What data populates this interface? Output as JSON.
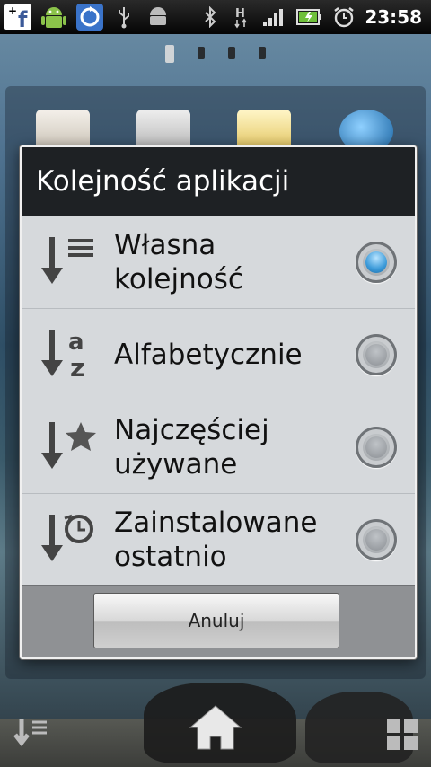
{
  "status_bar": {
    "time": "23:58",
    "icons": [
      "facebook-icon",
      "android-icon",
      "sync-icon",
      "usb-icon",
      "android-debug-icon",
      "bluetooth-icon",
      "hspa-data-icon",
      "signal-icon",
      "battery-charging-icon",
      "alarm-clock-icon"
    ]
  },
  "dialog": {
    "title": "Kolejność aplikacji",
    "options": [
      {
        "label": "Własna kolejność",
        "icon": "custom-order-icon",
        "selected": true
      },
      {
        "label": "Alfabetycznie",
        "icon": "alphabetical-icon",
        "selected": false
      },
      {
        "label": "Najczęściej\nużywane",
        "icon": "most-used-icon",
        "selected": false
      },
      {
        "label": "Zainstalowane\nostatnio",
        "icon": "recently-installed-icon",
        "selected": false
      }
    ],
    "cancel_label": "Anuluj"
  },
  "dock": {
    "left_icon": "sort-icon",
    "center_icon": "home-icon",
    "right_icon": "grid-icon"
  },
  "colors": {
    "selected_radio": "#3b9ad9",
    "title_bg": "#1e2124",
    "dialog_bg": "#d6d9dc"
  }
}
